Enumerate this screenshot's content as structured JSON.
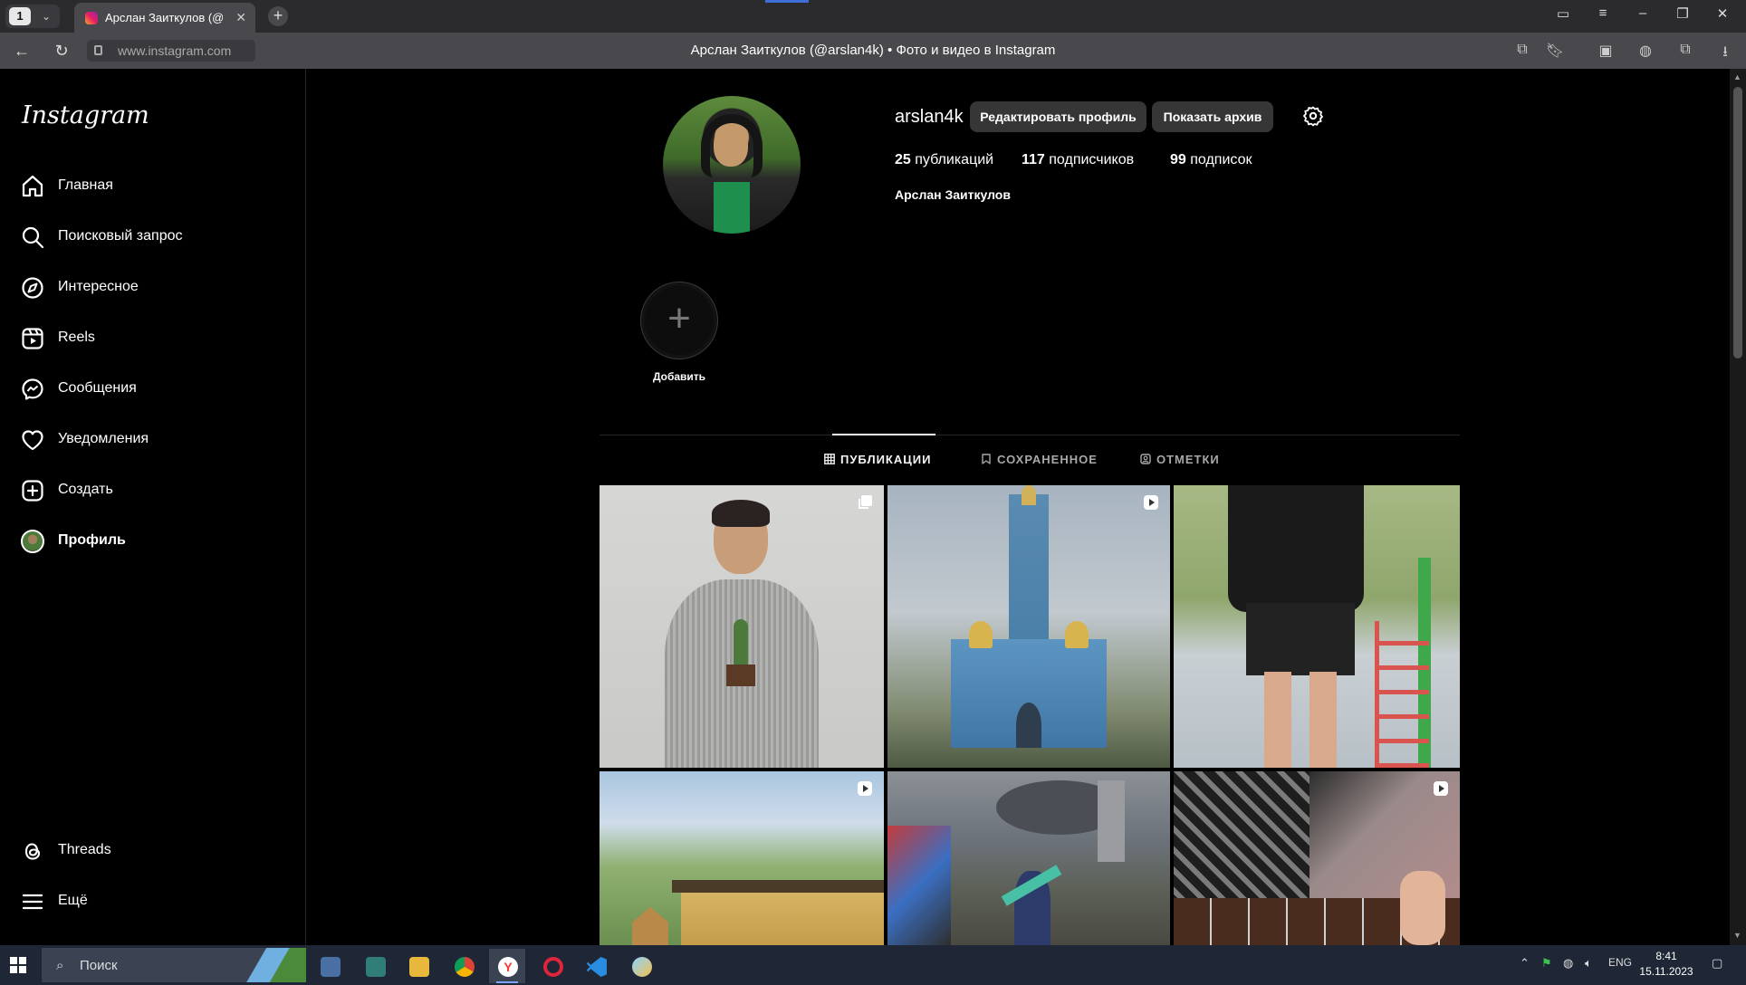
{
  "browser": {
    "tab_count": "1",
    "tab_title": "Арслан Заиткулов (@arslan4k)",
    "url": "www.instagram.com",
    "page_title": "Арслан Заиткулов (@arslan4k) • Фото и видео в Instagram"
  },
  "sidebar": {
    "logo": "Instagram",
    "items": [
      {
        "label": "Главная",
        "icon": "home-icon"
      },
      {
        "label": "Поисковый запрос",
        "icon": "search-icon"
      },
      {
        "label": "Интересное",
        "icon": "compass-icon"
      },
      {
        "label": "Reels",
        "icon": "reels-icon"
      },
      {
        "label": "Сообщения",
        "icon": "messenger-icon"
      },
      {
        "label": "Уведомления",
        "icon": "heart-icon"
      },
      {
        "label": "Создать",
        "icon": "plus-square-icon"
      },
      {
        "label": "Профиль",
        "icon": "avatar"
      }
    ],
    "bottom_items": [
      {
        "label": "Threads",
        "icon": "threads-icon"
      },
      {
        "label": "Ещё",
        "icon": "menu-icon"
      }
    ]
  },
  "profile": {
    "username": "arslan4k",
    "edit_button": "Редактировать профиль",
    "archive_button": "Показать архив",
    "posts_count": "25",
    "posts_label": "публикаций",
    "followers_count": "117",
    "followers_label": "подписчиков",
    "following_count": "99",
    "following_label": "подписок",
    "full_name": "Арслан Заиткулов"
  },
  "highlights": {
    "add_label": "Добавить"
  },
  "tabs": [
    {
      "label": "ПУБЛИКАЦИИ",
      "active": true
    },
    {
      "label": "СОХРАНЕННОЕ",
      "active": false
    },
    {
      "label": "ОТМЕТКИ",
      "active": false
    }
  ],
  "posts": [
    {
      "subject": "portrait-with-cactus",
      "badge": "carousel-icon"
    },
    {
      "subject": "blue-church",
      "badge": "reel-icon"
    },
    {
      "subject": "playground-black-tshirt",
      "badge": "none"
    },
    {
      "subject": "trees-and-shed",
      "badge": "reel-icon"
    },
    {
      "subject": "city-graffiti-skateboard",
      "badge": "none"
    },
    {
      "subject": "guitar-closeup",
      "badge": "reel-icon"
    }
  ],
  "taskbar": {
    "search_placeholder": "Поиск",
    "lang": "ENG",
    "time": "8:41",
    "date": "15.11.2023"
  },
  "colors": {
    "background": "#000000",
    "button_bg": "#363636",
    "divider": "#262626",
    "browser_chrome": "#48484d"
  }
}
